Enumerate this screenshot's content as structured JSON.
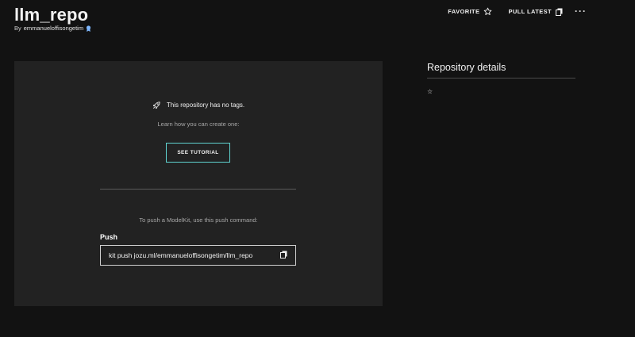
{
  "repo": {
    "title": "llm_repo",
    "by_label": "By",
    "owner": "emmanueloffisongetim"
  },
  "header_actions": {
    "favorite_label": "FAVORITE",
    "pull_latest_label": "PULL LATEST",
    "more_label": "···"
  },
  "empty_state": {
    "message": "This repository has no tags.",
    "learn": "Learn how you can create one:",
    "tutorial_button": "SEE TUTORIAL"
  },
  "push": {
    "hint": "To push a ModelKit, use this push command:",
    "label": "Push",
    "command": "kit push jozu.ml/emmanueloffisongetim/llm_repo"
  },
  "details": {
    "title": "Repository details",
    "star_glyph": "☆"
  },
  "icons": {
    "favorite": "star-icon",
    "pull_latest": "copy-icon",
    "empty_state": "rocket-icon",
    "owner_badge": "verified-badge-icon",
    "command_copy": "copy-icon"
  },
  "colors": {
    "background": "#121212",
    "panel": "#222222",
    "accent": "#5fd3d0",
    "badge": "#7fb8ff"
  }
}
